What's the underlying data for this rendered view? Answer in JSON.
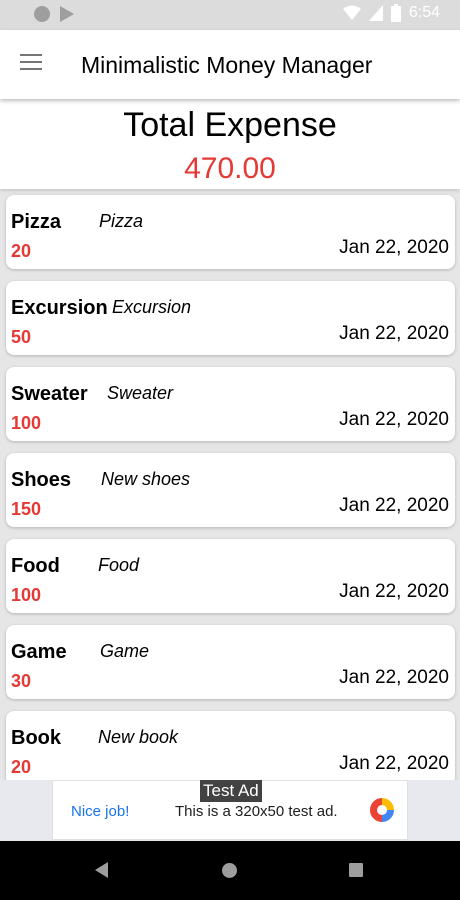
{
  "status_bar": {
    "time": "6:54"
  },
  "app_bar": {
    "title": "Minimalistic Money Manager"
  },
  "summary": {
    "label": "Total Expense",
    "value": "470.00"
  },
  "expenses": [
    {
      "name": "Pizza",
      "note": "Pizza",
      "amount": "20",
      "date": "Jan 22, 2020"
    },
    {
      "name": "Excursion",
      "note": "Excursion",
      "amount": "50",
      "date": "Jan 22, 2020"
    },
    {
      "name": "Sweater",
      "note": "Sweater",
      "amount": "100",
      "date": "Jan 22, 2020"
    },
    {
      "name": "Shoes",
      "note": "New shoes",
      "amount": "150",
      "date": "Jan 22, 2020"
    },
    {
      "name": "Food",
      "note": "Food",
      "amount": "100",
      "date": "Jan 22, 2020"
    },
    {
      "name": "Game",
      "note": "Game",
      "amount": "30",
      "date": "Jan 22, 2020"
    },
    {
      "name": "Book",
      "note": "New book",
      "amount": "20",
      "date": "Jan 22, 2020"
    }
  ],
  "ad": {
    "badge": "Test Ad",
    "cta": "Nice job!",
    "text": "This is a 320x50 test ad."
  },
  "colors": {
    "accent_red": "#e53935",
    "link_blue": "#1a73e8"
  }
}
